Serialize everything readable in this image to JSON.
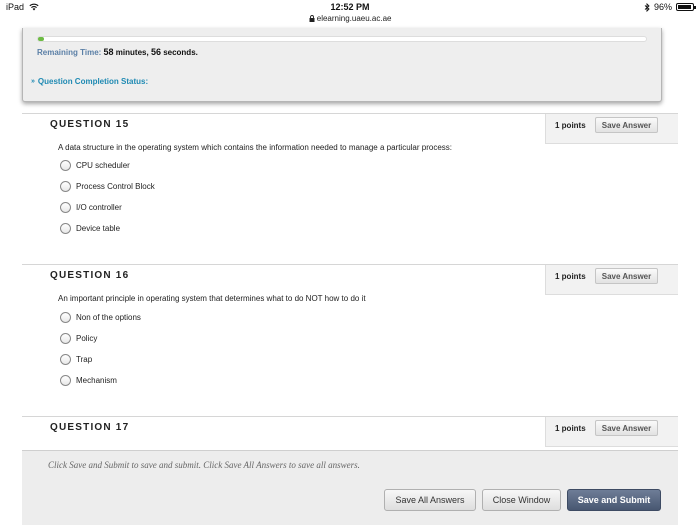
{
  "status_bar": {
    "device": "iPad",
    "time": "12:52 PM",
    "url": "elearning.uaeu.ac.ae",
    "battery": "96%",
    "battery_level": 0.96
  },
  "timer": {
    "progress_fraction": 0.01,
    "label": "Remaining Time:",
    "minutes": "58",
    "minutes_unit": "minutes,",
    "seconds": "56",
    "seconds_unit": "seconds.",
    "completion_status": "Question Completion Status:"
  },
  "questions": [
    {
      "title": "QUESTION 15",
      "points": "1 points",
      "save_label": "Save Answer",
      "text": "A data structure in the operating system which contains the information needed to manage a particular process:",
      "options": [
        "CPU scheduler",
        "Process Control Block",
        "I/O controller",
        "Device table"
      ]
    },
    {
      "title": "QUESTION 16",
      "points": "1 points",
      "save_label": "Save Answer",
      "text": "An important principle in operating system that determines what to do NOT how to do it",
      "options": [
        "Non of the options",
        "Policy",
        "Trap",
        "Mechanism"
      ]
    },
    {
      "title": "QUESTION 17",
      "points": "1 points",
      "save_label": "Save Answer"
    }
  ],
  "footer": {
    "help_text": "Click Save and Submit to save and submit. Click Save All Answers to save all answers.",
    "save_all_label": "Save All Answers",
    "close_label": "Close Window",
    "submit_label": "Save and Submit"
  },
  "colors": {
    "progress": "#6dbb44",
    "completion_link": "#1f8ab3",
    "submit_button": "#485771"
  }
}
